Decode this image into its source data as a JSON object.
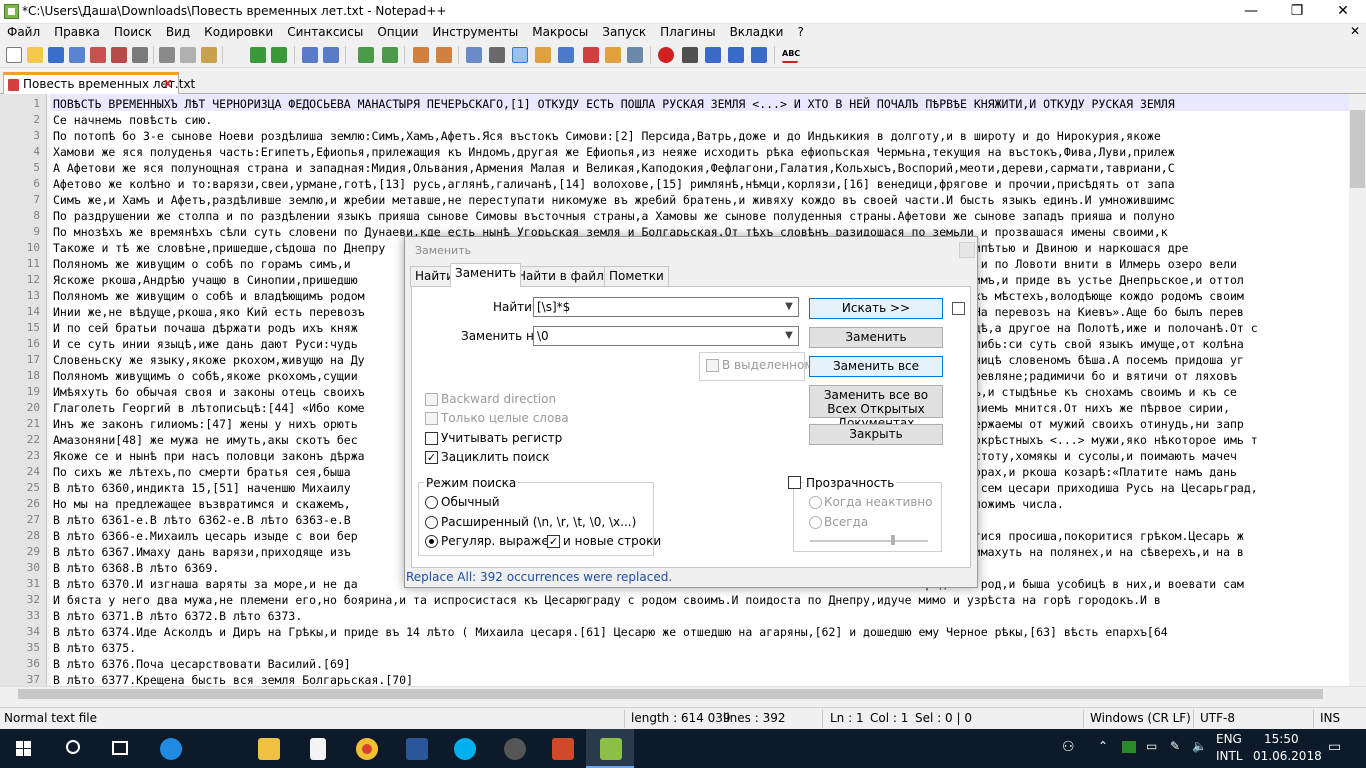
{
  "window": {
    "title": "*C:\\Users\\Даша\\Downloads\\Повесть временных лет.txt - Notepad++"
  },
  "menu": [
    "Файл",
    "Правка",
    "Поиск",
    "Вид",
    "Кодировки",
    "Синтаксисы",
    "Опции",
    "Инструменты",
    "Макросы",
    "Запуск",
    "Плагины",
    "Вкладки",
    "?"
  ],
  "menu_close": "✕",
  "tab": {
    "label": "Повесть временных лет.txt",
    "close": "x"
  },
  "editor": {
    "lines": [
      {
        "n": "1",
        "text": "ПОВѢСТЬ ВРЕМЕННЫХЪ ЛѢТ ЧЕРНОРИЗЦА ФЕДОСЬЕВА МАНАСТЫРЯ ПЕЧЕРЬСКАГО,[1] ОТКУДУ ЕСТЬ ПОШЛА РУСКАЯ ЗЕМЛЯ <...> И ХТО В НЕЙ ПОЧАЛЪ ПѢРВѢЕ КНЯЖИТИ,И ОТКУДУ РУСКАЯ ЗЕМЛЯ"
      },
      {
        "n": "2",
        "text": "Се начнемь повѣсть сию."
      },
      {
        "n": "3",
        "text": "По потопѣ бо 3-е сынове Ноеви роздѣлиша землю:Симъ,Хамъ,Афетъ.Яся въстокъ Симови:[2] Персида,Ватрь,доже и до Индькикия в долготу,и в широту и до Нирокурия,якоже"
      },
      {
        "n": "4",
        "text": "Хамови же яся полуденья часть:Египетъ,Ефиопья,прилежащия къ Индомъ,другая же Ефиопья,из неяже исходить рѣка ефиопьская Чермьна,текущия на въстокъ,Фива,Луви,прилеж"
      },
      {
        "n": "5",
        "text": "А Афетови же яся полунощная страна и западная:Мидия,Ольвания,Армения Малая и Великая,Каподокия,Фефлагони,Галатия,Кольхысъ,Воспорий,меоти,дереви,сармати,тавриани,С"
      },
      {
        "n": "6",
        "text": "Афетово же колѣно и то:варязи,свеи,урмане,готѣ,[13] русь,аглянѣ,галичанѣ,[14] волохове,[15] римлянѣ,нѣмци,корлязи,[16] венедици,фрягове и прочии,присѣдять от запа"
      },
      {
        "n": "7",
        "text": "Симъ же,и Хамъ и Афетъ,раздѣливше землю,и жребии метавше,не переступати никомуже въ жребий братень,и живяху кождо въ своей части.И бысть языкъ единъ.И умножившимс"
      },
      {
        "n": "8",
        "text": "По раздрушении же столпа и по раздѣлении языкъ прияша сынове Симовы въсточныя страны,а Хамовы же сынове полуденныя страны.Афетови же сынове западъ прияша и полуно"
      },
      {
        "n": "9",
        "text": "По мнозѣхъ же времянѣхъ сѣли суть словени по Дунаеви,кде есть нынѣ Угорьская земля и Болгарьская.От тѣхъ словѣнъ разидошася по земьли и прозвашася имены своими,к"
      },
      {
        "n": "10",
        "text": "Такоже и тѣ же словѣне,пришедше,сѣдоша по Днепру                                                                       сѣдоша межи Припѣтью и Двиною и наркошася дре"
      },
      {
        "n": "11",
        "text": "Поляномъ же живущим о собѣ по горамъ симъ,и                                                                                    Ловоти,и по Ловоти внити в Илмерь озеро вели"
      },
      {
        "n": "12",
        "text": "Яскоже ркоша,Андрѣю учащю в Синопии,пришедшю                                                                                  ити в Римъ,и приде въ устье Днепрьское,и оттол"
      },
      {
        "n": "13",
        "text": "Поляномъ же живущим о собѣ и владѣющимъ родом                                                                                 на своихъ мѣстехъ,володѣюще кождо родомъ своим"
      },
      {
        "n": "14",
        "text": "Инии же,не вѣдуще,ркоша,яко Кий есть перевозъ                                                                                 алаху:«На перевозъ на Киевъ».Аще бо былъ перев"
      },
      {
        "n": "15",
        "text": "И по сей братьи почаша дѣржати родъ ихъ княж                                                                                   вѣгородѣ,а другое на Полотѣ,иже и полочанѣ.От с"
      },
      {
        "n": "16",
        "text": "И се суть инии языцѣ,иже дань дают Руси:чудь                                                                                  нерома,либь:си суть свой языкъ имуще,от колѣна"
      },
      {
        "n": "17",
        "text": "Словеньску же языку,якоже ркохом,живущю на Ду                                                                                 ,насѣльницѣ словеномъ бѣша.А посемъ придоша уг"
      },
      {
        "n": "18",
        "text": "Поляномъ живущимъ о собѣ,якоже ркохомъ,сущии                                                                                  ошася древляне;радимичи бо и вятичи от ляховъ"
      },
      {
        "n": "19",
        "text": "Имѣяхуть бо обычая своя и законы отець своихъ                                                                                 и кроткъ,и стыдѣнье къ снохамъ своимъ и къ се"
      },
      {
        "n": "20",
        "text": "Глаголеть Георгий в лѣтописьцѣ:[44] «Ибо коме                                                                                 отечьствиемь мнится.От нихъ же пѣрвое сирии,"
      },
      {
        "n": "21",
        "text": "Инъ же законъ гилиомъ:[47] жены у нихъ орють                                                                                  не въздержаемы от мужий своихъ отинудь,ни запр"
      },
      {
        "n": "22",
        "text": "Амазоняни[48] же мужа не имуть,акы скотъ бес                                                                                  рся от окрѣстныхъ <...> мужи,яко нѣкоторое имь т"
      },
      {
        "n": "23",
        "text": "Якоже се и нынѣ при насъ половци законъ дѣржа                                                                                всю нечистоту,хомякы и сусолы,и поимають мачеч"
      },
      {
        "n": "24",
        "text": "По сихъ же лѣтехъ,по смерти братья сея,быша                                                                                   къ на горах,и ркоша козарѣ:«Платите намъ дань"
      },
      {
        "n": "25",
        "text": "В лѣто 6360,индикта 15,[51] наченшю Михаилу                                                                                   ряо при сем цесари приходиша Русь на Цесарьград,"
      },
      {
        "n": "26",
        "text": "Но мы на предлежащее възвратимся и скажемъ,                                                                                   ряду положимъ числа."
      },
      {
        "n": "27",
        "text": "В лѣто 6361-е.В лѣто 6362-е.В лѣто 6363-е.В"
      },
      {
        "n": "28",
        "text": "В лѣто 6366-е.Михаилъ цесарь изыде с вои бер                                                                                  ,креститися просиша,покоритися грѣком.Цесарь ж"
      },
      {
        "n": "29",
        "text": "В лѣто 6367.Имаху дань варязи,приходяще изъ                                                                                   козаре имахуть на полянех,и на сѣверехъ,и на в"
      },
      {
        "n": "30",
        "text": "В лѣто 6368.В лѣто 6369."
      },
      {
        "n": "31",
        "text": "В лѣто 6370.И изгнаша варяты за море,и не да                                                                                  родъ на род,и быша усобицѣ в них,и воевати сам"
      },
      {
        "n": "32",
        "text": "И бяста у него два мужа,не племени его,но боярина,и та испросистася къ Цесарюграду с родом своимъ.И поидоста по Днепру,идуче мимо и узрѣста на горѣ городокъ.И в"
      },
      {
        "n": "33",
        "text": "В лѣто 6371.В лѣто 6372.В лѣто 6373."
      },
      {
        "n": "34",
        "text": "В лѣто 6374.Иде Асколдъ и Диръ на Грѣкы,и приде въ 14 лѣто ( Михаила цесаря.[61] Цесарю же отшедшю на агаряны,[62] и дошедшю ему Черное рѣкы,[63] вѣсть епархъ[64"
      },
      {
        "n": "35",
        "text": "В лѣто 6375."
      },
      {
        "n": "36",
        "text": "В лѣто 6376.Поча цесарствовати Василий.[69]"
      },
      {
        "n": "37",
        "text": "В лѣто 6377.Крещена бысть вся земля Болгарьская.[70]"
      }
    ]
  },
  "dialog": {
    "title": "Заменить",
    "tabs": [
      "Найти",
      "Заменить",
      "Найти в файлах",
      "Пометки"
    ],
    "find_label": "Найти:",
    "find_value": "[\\s]*$",
    "replace_label": "Заменить на:",
    "replace_value": "\\0",
    "in_selection": "В выделенном",
    "backward": "Backward direction",
    "whole_word": "Только целые слова",
    "match_case": "Учитывать регистр",
    "wrap": "Зациклить поиск",
    "mode_title": "Режим поиска",
    "mode_normal": "Обычный",
    "mode_extended": "Расширенный (\\n, \\r, \\t, \\0, \\x...)",
    "mode_regex": "Регуляр. выражен.",
    "newlines": "и новые строки",
    "transparency": "Прозрачность",
    "when_inactive": "Когда неактивно",
    "always": "Всегда",
    "btn_find_next": "Искать >>",
    "btn_replace": "Заменить",
    "btn_replace_all": "Заменить все",
    "btn_replace_all_docs": "Заменить все во Всех Открытых Документах",
    "btn_close": "Закрыть",
    "status": "Replace All: 392 occurrences were replaced."
  },
  "status": {
    "type": "Normal text file",
    "length": "length : 614 039",
    "lines": "lines : 392",
    "ln": "Ln : 1",
    "col": "Col : 1",
    "sel": "Sel : 0 | 0",
    "eol": "Windows (CR LF)",
    "encoding": "UTF-8",
    "mode": "INS"
  },
  "taskbar": {
    "lang": "ENG",
    "layout": "INTL",
    "time": "15:50",
    "date": "01.06.2018"
  },
  "colors": {
    "accent": "#0078d7",
    "taskbar": "#0c1a2a"
  }
}
